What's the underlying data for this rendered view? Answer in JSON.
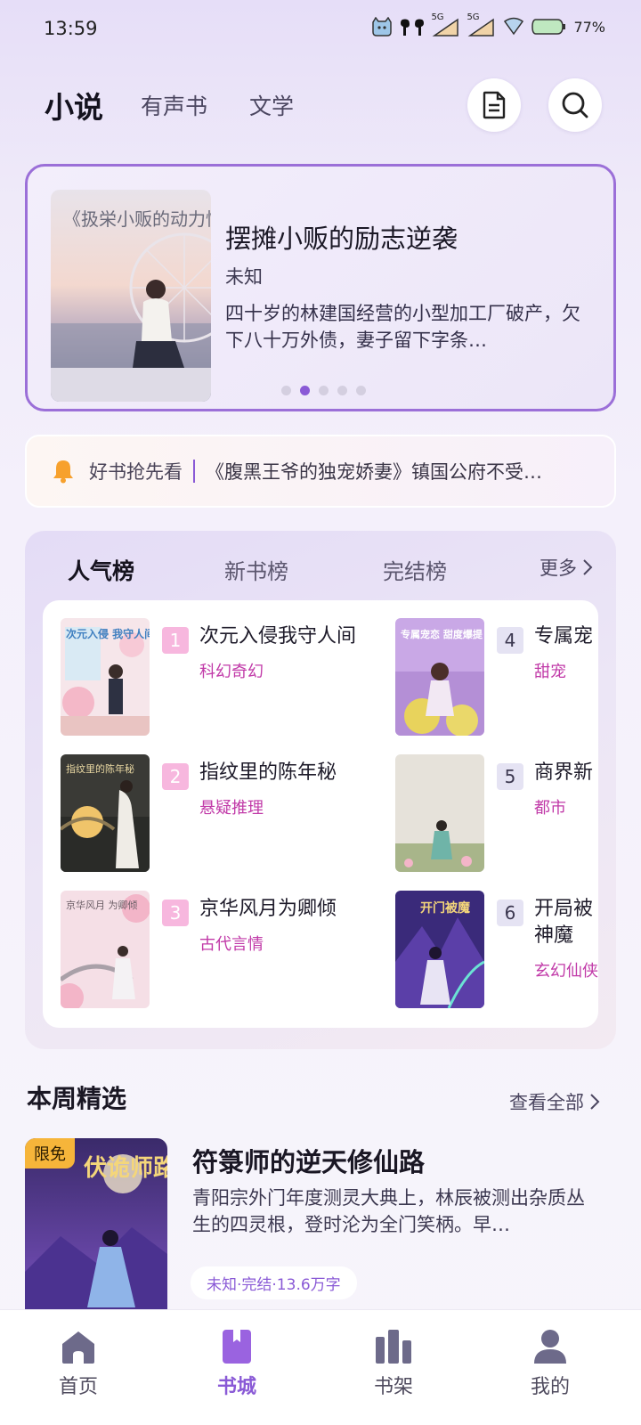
{
  "status": {
    "time": "13:59",
    "battery": "77%",
    "signal1": "5G",
    "signal2": "5G"
  },
  "top_nav": {
    "tabs": [
      "小说",
      "有声书",
      "文学"
    ]
  },
  "hero": {
    "cover_text": "《扱栄小贩的动力慢帝",
    "title": "摆摊小贩的励志逆袭",
    "author": "未知",
    "description": "四十岁的林建国经营的小型加工厂破产，欠下八十万外债，妻子留下字条…",
    "dots": 5,
    "active_dot": 1
  },
  "notice": {
    "label": "好书抢先看",
    "text": "《腹黑王爷的独宠娇妻》镇国公府不受…"
  },
  "ranking": {
    "tabs": [
      "人气榜",
      "新书榜",
      "完结榜"
    ],
    "more": "更多",
    "items": [
      {
        "rank": "1",
        "title": "次元入侵我守人间",
        "genre": "科幻奇幻",
        "cover_text": "次元入侵 我守人间"
      },
      {
        "rank": "2",
        "title": "指纹里的陈年秘",
        "genre": "悬疑推理",
        "cover_text": "指纹里的陈年秘"
      },
      {
        "rank": "3",
        "title": "京华风月为卿倾",
        "genre": "古代言情",
        "cover_text": "京华风月 为卿倾"
      },
      {
        "rank": "4",
        "title": "专属宠",
        "genre": "甜宠",
        "cover_text": "专属宠恋 甜度爆提"
      },
      {
        "rank": "5",
        "title": "商界新",
        "genre": "都市",
        "cover_text": ""
      },
      {
        "rank": "6",
        "title": "开局被\n神魔",
        "genre": "玄幻仙侠",
        "cover_text": "开门被魔"
      }
    ]
  },
  "weekly": {
    "heading": "本周精选",
    "view_all": "查看全部",
    "badge": "限免",
    "cover_text": "伏诡师路",
    "title": "符箓师的逆天修仙路",
    "description": "青阳宗外门年度测灵大典上，林辰被测出杂质丛生的四灵根，登时沦为全门笑柄。早…",
    "meta": "未知·完结·13.6万字"
  },
  "bottom_nav": {
    "items": [
      "首页",
      "书城",
      "书架",
      "我的"
    ],
    "active": "书城"
  }
}
